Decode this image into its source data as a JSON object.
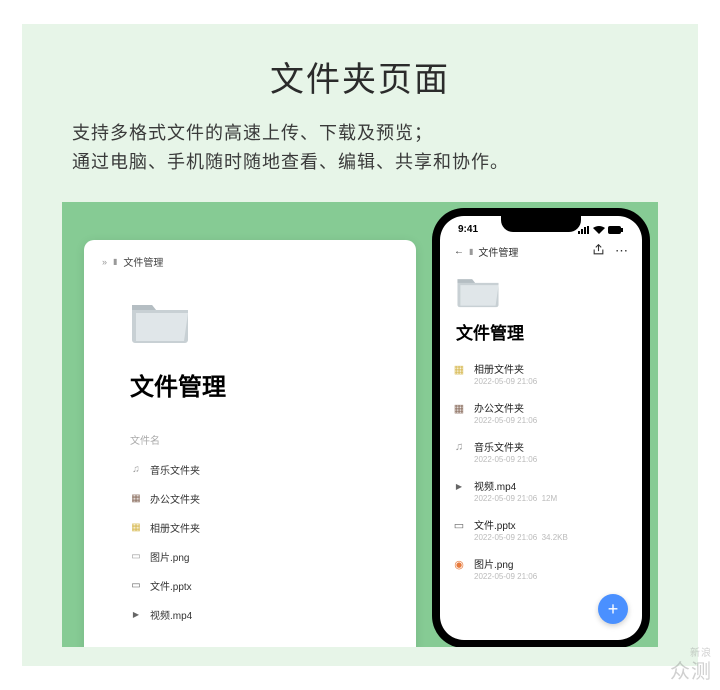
{
  "page": {
    "title": "文件夹页面",
    "subtitle_line1": "支持多格式文件的高速上传、下载及预览；",
    "subtitle_line2": "通过电脑、手机随时随地查看、编辑、共享和协作。"
  },
  "desktop": {
    "breadcrumb_sep": "»",
    "breadcrumb_label": "文件管理",
    "panel_title": "文件管理",
    "column_header": "文件名",
    "files": [
      {
        "icon": "ico-music",
        "name": "音乐文件夹"
      },
      {
        "icon": "ico-office",
        "name": "办公文件夹"
      },
      {
        "icon": "ico-album",
        "name": "相册文件夹"
      },
      {
        "icon": "ico-png",
        "name": "图片.png"
      },
      {
        "icon": "ico-pptx",
        "name": "文件.pptx"
      },
      {
        "icon": "ico-mp4",
        "name": "视频.mp4"
      }
    ]
  },
  "phone": {
    "time": "9:41",
    "breadcrumb_label": "文件管理",
    "panel_title": "文件管理",
    "files": [
      {
        "icon": "ico-album",
        "name": "相册文件夹",
        "date": "2022-05-09 21:06",
        "size": ""
      },
      {
        "icon": "ico-office",
        "name": "办公文件夹",
        "date": "2022-05-09 21:06",
        "size": ""
      },
      {
        "icon": "ico-music",
        "name": "音乐文件夹",
        "date": "2022-05-09 21:06",
        "size": ""
      },
      {
        "icon": "ico-mp4",
        "name": "视频.mp4",
        "date": "2022-05-09 21:06",
        "size": "12M"
      },
      {
        "icon": "ico-pptx",
        "name": "文件.pptx",
        "date": "2022-05-09 21:06",
        "size": "34.2KB"
      },
      {
        "icon": "ico-img",
        "name": "图片.png",
        "date": "2022-05-09 21:06",
        "size": ""
      }
    ]
  },
  "watermark": {
    "small": "新浪",
    "large": "众测"
  }
}
